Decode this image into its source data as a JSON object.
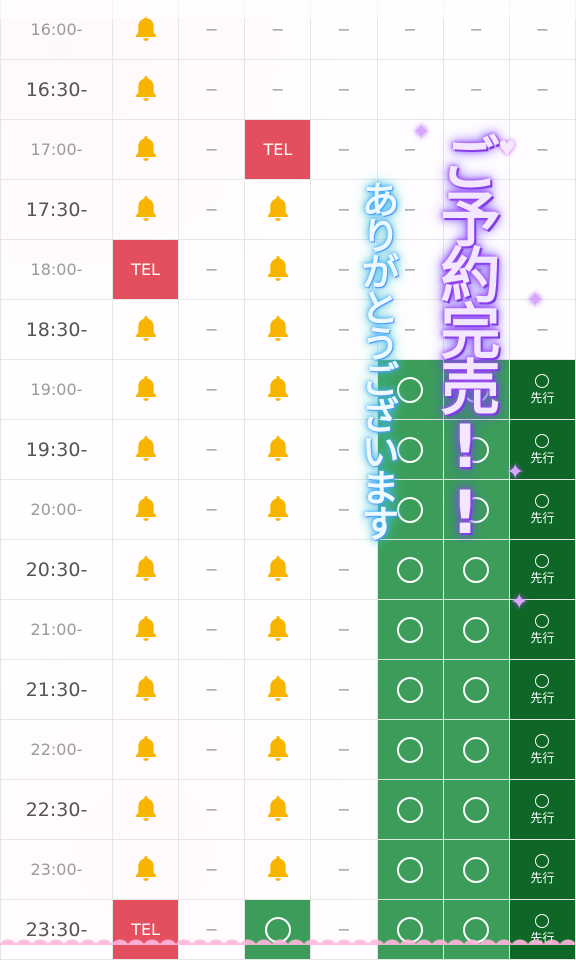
{
  "table": {
    "rows": [
      {
        "time": "16:00-",
        "cells": [
          "bell",
          "-",
          "-",
          "-",
          "-",
          "-",
          "-"
        ]
      },
      {
        "time": "16:30-",
        "cells": [
          "bell",
          "-",
          "-",
          "-",
          "-",
          "-",
          "-"
        ]
      },
      {
        "time": "17:00-",
        "cells": [
          "bell",
          "-",
          "TEL",
          "-",
          "-",
          "-",
          "-"
        ]
      },
      {
        "time": "17:30-",
        "cells": [
          "bell",
          "-",
          "bell",
          "-",
          "-",
          "-",
          "-"
        ]
      },
      {
        "time": "18:00-",
        "cells": [
          "TEL",
          "-",
          "bell",
          "-",
          "-",
          "-",
          "-"
        ]
      },
      {
        "time": "18:30-",
        "cells": [
          "bell",
          "-",
          "bell",
          "-",
          "-",
          "-",
          "-"
        ]
      },
      {
        "time": "19:00-",
        "cells": [
          "bell",
          "-",
          "bell",
          "-",
          "circle",
          "circle",
          "adv"
        ]
      },
      {
        "time": "19:30-",
        "cells": [
          "bell",
          "-",
          "bell",
          "-",
          "circle",
          "circle",
          "adv"
        ]
      },
      {
        "time": "20:00-",
        "cells": [
          "bell",
          "-",
          "bell",
          "-",
          "circle",
          "circle",
          "adv"
        ]
      },
      {
        "time": "20:30-",
        "cells": [
          "bell",
          "-",
          "bell",
          "-",
          "circle",
          "circle",
          "adv"
        ]
      },
      {
        "time": "21:00-",
        "cells": [
          "bell",
          "-",
          "bell",
          "-",
          "circle",
          "circle",
          "adv"
        ]
      },
      {
        "time": "21:30-",
        "cells": [
          "bell",
          "-",
          "bell",
          "-",
          "circle",
          "circle",
          "adv"
        ]
      },
      {
        "time": "22:00-",
        "cells": [
          "bell",
          "-",
          "bell",
          "-",
          "circle",
          "circle",
          "adv"
        ]
      },
      {
        "time": "22:30-",
        "cells": [
          "bell",
          "-",
          "bell",
          "-",
          "circle",
          "circle",
          "adv"
        ]
      },
      {
        "time": "23:00-",
        "cells": [
          "bell",
          "-",
          "bell",
          "-",
          "circle",
          "circle",
          "adv"
        ]
      },
      {
        "time": "23:30-",
        "cells": [
          "TEL",
          "-",
          "circle",
          "-",
          "circle",
          "circle",
          "adv"
        ]
      }
    ],
    "labels": {
      "tel": "TEL",
      "dash": "−",
      "advance": "先行"
    }
  },
  "overlay": {
    "main_text": "ご予約完売!!",
    "sub_text": "ありがとうございます"
  },
  "colors": {
    "tel_red": "#e34f5d",
    "bell_yellow": "#f7b500",
    "green_light": "#3c9d5a",
    "green_mid": "#1d7a36",
    "green_dark": "#0e6726"
  },
  "icons": {
    "bell": "bell-icon",
    "circle": "available-circle-icon"
  }
}
